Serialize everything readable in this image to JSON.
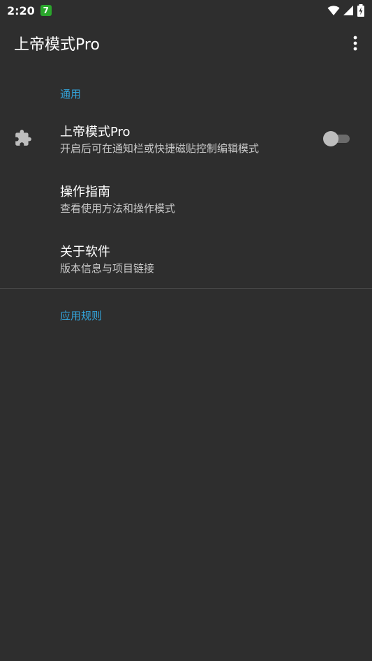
{
  "status_bar": {
    "time": "2:20",
    "app_badge": "7",
    "icons": [
      "wifi-icon",
      "signal-icon",
      "battery-charging-icon"
    ]
  },
  "app_bar": {
    "title": "上帝模式Pro",
    "menu_icon": "more-vert-icon"
  },
  "sections": {
    "general": {
      "header": "通用",
      "items": [
        {
          "title": "上帝模式Pro",
          "summary": "开启后可在通知栏或快捷磁贴控制编辑模式",
          "icon": "puzzle-icon",
          "switch_on": false
        },
        {
          "title": "操作指南",
          "summary": "查看使用方法和操作模式"
        },
        {
          "title": "关于软件",
          "summary": "版本信息与项目链接"
        }
      ]
    },
    "rules": {
      "header": "应用规则"
    }
  },
  "colors": {
    "background": "#2e2e2e",
    "accent": "#33a3d9",
    "summary_text": "#c8c8c8",
    "badge": "#2aa62c"
  }
}
